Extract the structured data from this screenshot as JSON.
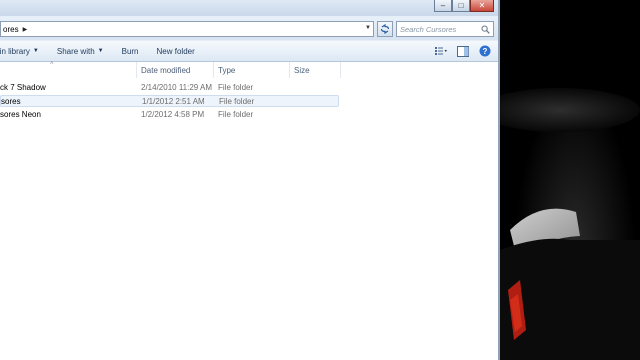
{
  "window": {
    "address": {
      "path": "ores"
    },
    "search": {
      "placeholder": "Search Cursores"
    }
  },
  "toolbar": {
    "items": [
      {
        "label": "e in library",
        "has_dropdown": true
      },
      {
        "label": "Share with",
        "has_dropdown": true
      },
      {
        "label": "Burn",
        "has_dropdown": false
      },
      {
        "label": "New folder",
        "has_dropdown": false
      }
    ]
  },
  "columns": [
    "Date modified",
    "Type",
    "Size"
  ],
  "files": [
    {
      "name": "ck 7 Shadow",
      "date": "2/14/2010 11:29 AM",
      "type": "File folder",
      "size": "",
      "selected": false
    },
    {
      "name": "sores",
      "date": "1/1/2012 2:51 AM",
      "type": "File folder",
      "size": "",
      "selected": true
    },
    {
      "name": "sores Neon",
      "date": "1/2/2012 4:58 PM",
      "type": "File folder",
      "size": "",
      "selected": false
    }
  ],
  "colors": {
    "accent": "#1e395b",
    "selection": "#eef4fb",
    "help": "#2f6fd0"
  }
}
